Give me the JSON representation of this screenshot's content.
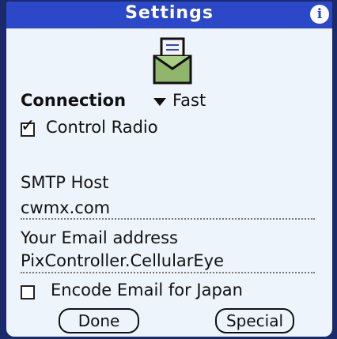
{
  "titlebar": {
    "title": "Settings",
    "info_icon": "i"
  },
  "connection": {
    "label": "Connection",
    "value": "Fast"
  },
  "control_radio": {
    "label": "Control Radio",
    "checked": true
  },
  "smtp": {
    "label": "SMTP Host",
    "value": "cwmx.com"
  },
  "email": {
    "label": "Your Email address",
    "value": "PixController.CellularEye"
  },
  "japan": {
    "label": "Encode Email for Japan",
    "checked": false
  },
  "buttons": {
    "done": "Done",
    "special": "Special"
  },
  "colors": {
    "titlebar": "#2b48c9",
    "background": "#eef4fb"
  }
}
